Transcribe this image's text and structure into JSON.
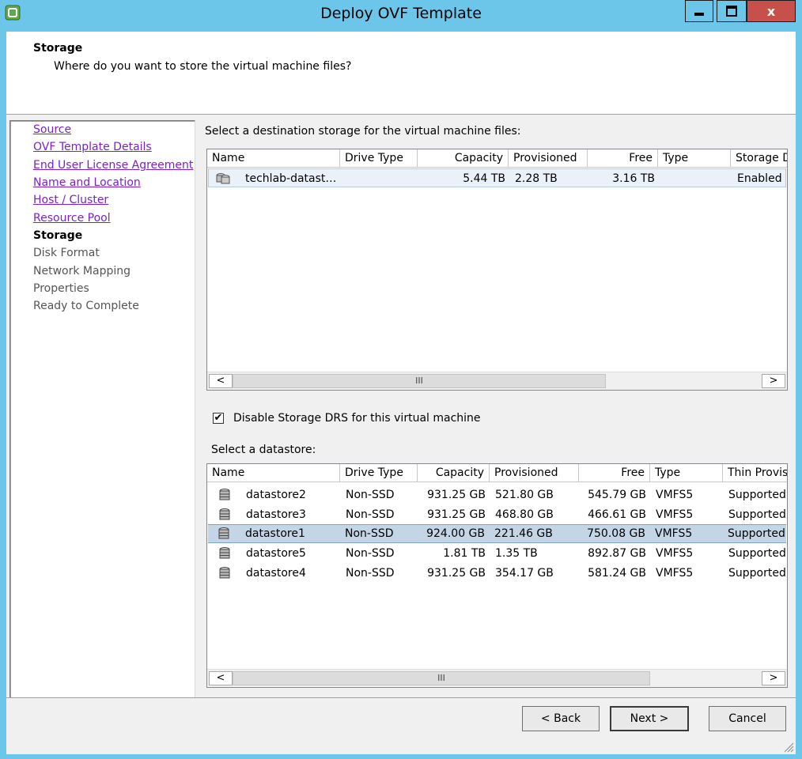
{
  "window": {
    "title": "Deploy OVF Template",
    "close_label": "x"
  },
  "header": {
    "title": "Storage",
    "subtitle": "Where do you want to store the virtual machine files?"
  },
  "nav": {
    "items": [
      {
        "label": "Source",
        "state": "completed"
      },
      {
        "label": "OVF Template Details",
        "state": "completed"
      },
      {
        "label": "End User License Agreement",
        "state": "completed"
      },
      {
        "label": "Name and Location",
        "state": "completed"
      },
      {
        "label": "Host / Cluster",
        "state": "completed"
      },
      {
        "label": "Resource Pool",
        "state": "completed"
      },
      {
        "label": "Storage",
        "state": "current"
      },
      {
        "label": "Disk Format",
        "state": "pending"
      },
      {
        "label": "Network Mapping",
        "state": "pending"
      },
      {
        "label": "Properties",
        "state": "pending"
      },
      {
        "label": "Ready to Complete",
        "state": "pending"
      }
    ]
  },
  "destination": {
    "prompt": "Select a destination storage for the virtual machine files:",
    "columns": [
      "Name",
      "Drive Type",
      "Capacity",
      "Provisioned",
      "Free",
      "Type",
      "Storage D"
    ],
    "rows": [
      {
        "name": "techlab-datast…",
        "drive_type": "",
        "capacity": "5.44 TB",
        "provisioned": "2.28 TB",
        "free": "3.16 TB",
        "type": "",
        "storage_drs": "Enabled",
        "icon": "datastore-cluster-icon"
      }
    ]
  },
  "disable_drs": {
    "label": "Disable Storage DRS for this virtual machine",
    "checked": true
  },
  "datastores": {
    "prompt": "Select a datastore:",
    "columns": [
      "Name",
      "Drive Type",
      "Capacity",
      "Provisioned",
      "Free",
      "Type",
      "Thin Provis"
    ],
    "selected_index": 2,
    "rows": [
      {
        "name": "datastore2",
        "drive_type": "Non-SSD",
        "capacity": "931.25 GB",
        "provisioned": "521.80 GB",
        "free": "545.79 GB",
        "type": "VMFS5",
        "thin": "Supported"
      },
      {
        "name": "datastore3",
        "drive_type": "Non-SSD",
        "capacity": "931.25 GB",
        "provisioned": "468.80 GB",
        "free": "466.61 GB",
        "type": "VMFS5",
        "thin": "Supported"
      },
      {
        "name": "datastore1",
        "drive_type": "Non-SSD",
        "capacity": "924.00 GB",
        "provisioned": "221.46 GB",
        "free": "750.08 GB",
        "type": "VMFS5",
        "thin": "Supported"
      },
      {
        "name": "datastore5",
        "drive_type": "Non-SSD",
        "capacity": "1.81 TB",
        "provisioned": "1.35 TB",
        "free": "892.87 GB",
        "type": "VMFS5",
        "thin": "Supported"
      },
      {
        "name": "datastore4",
        "drive_type": "Non-SSD",
        "capacity": "931.25 GB",
        "provisioned": "354.17 GB",
        "free": "581.24 GB",
        "type": "VMFS5",
        "thin": "Supported"
      }
    ]
  },
  "scroll": {
    "left": "<",
    "right": ">",
    "thumb": "III"
  },
  "buttons": {
    "back": "< Back",
    "next": "Next >",
    "cancel": "Cancel"
  },
  "colors": {
    "titlebar": "#6cc6ea",
    "link": "#7a1fd4",
    "selection": "#c4d5e6",
    "close": "#c7504a"
  }
}
